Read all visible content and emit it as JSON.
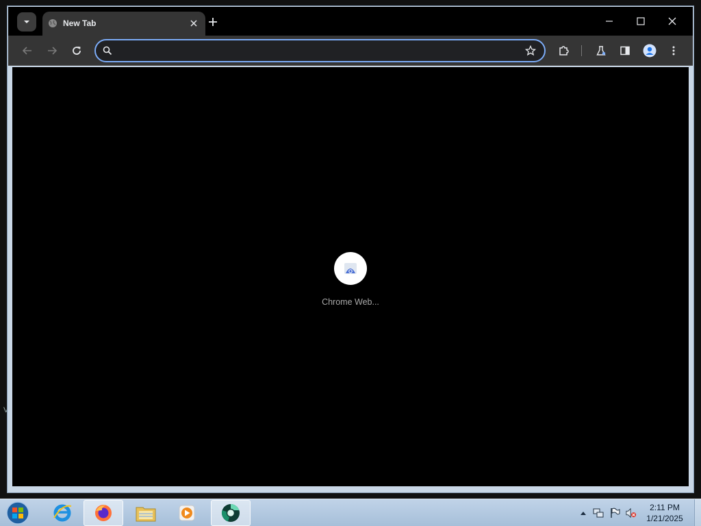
{
  "desktop": {
    "stray_text": "V"
  },
  "browser": {
    "tab": {
      "title": "New Tab",
      "favicon": "globe-icon"
    },
    "omnibox": {
      "value": "",
      "placeholder": ""
    },
    "accent": "#7cacf8",
    "toolbar_icons": [
      "back-arrow-icon",
      "forward-arrow-icon",
      "reload-icon",
      "star-icon",
      "puzzle-icon",
      "flask-icon",
      "sidepanel-icon",
      "profile-icon",
      "kebab-menu-icon"
    ]
  },
  "page": {
    "shortcuts": [
      {
        "label": "Chrome Web...",
        "icon": "chrome-web-store-icon"
      }
    ]
  },
  "taskbar": {
    "apps": [
      "windows-start-orb",
      "internet-explorer",
      "firefox",
      "file-explorer",
      "media-player",
      "chrome-dev"
    ],
    "clock": {
      "time": "2:11 PM",
      "date": "1/21/2025"
    }
  }
}
